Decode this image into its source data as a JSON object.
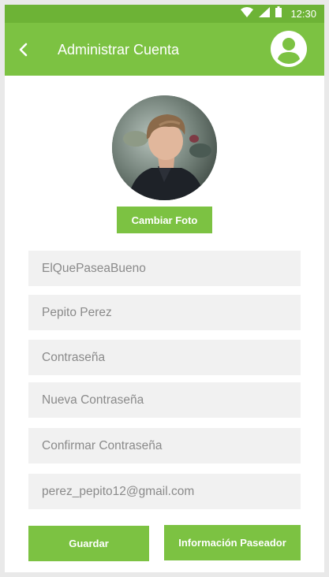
{
  "status_bar": {
    "time": "12:30",
    "icons": [
      "wifi-icon",
      "signal-icon",
      "battery-icon"
    ]
  },
  "app_bar": {
    "back_icon": "chevron-left-icon",
    "title": "Administrar Cuenta",
    "profile_icon": "account-circle-icon"
  },
  "profile": {
    "change_photo_label": "Cambiar Foto"
  },
  "form": {
    "username_value": "ElQuePaseaBueno",
    "full_name_value": "Pepito Perez",
    "password_placeholder": "Contraseña",
    "new_password_placeholder": "Nueva Contraseña",
    "confirm_password_placeholder": "Confirmar Contraseña",
    "email_value": "perez_pepito12@gmail.com"
  },
  "actions": {
    "save_label": "Guardar",
    "walker_info_label": "Información Paseador"
  },
  "colors": {
    "status_bar": "#6db336",
    "primary": "#7cc242",
    "field_bg": "#f1f1f1",
    "placeholder_text": "#8a8a8a"
  }
}
